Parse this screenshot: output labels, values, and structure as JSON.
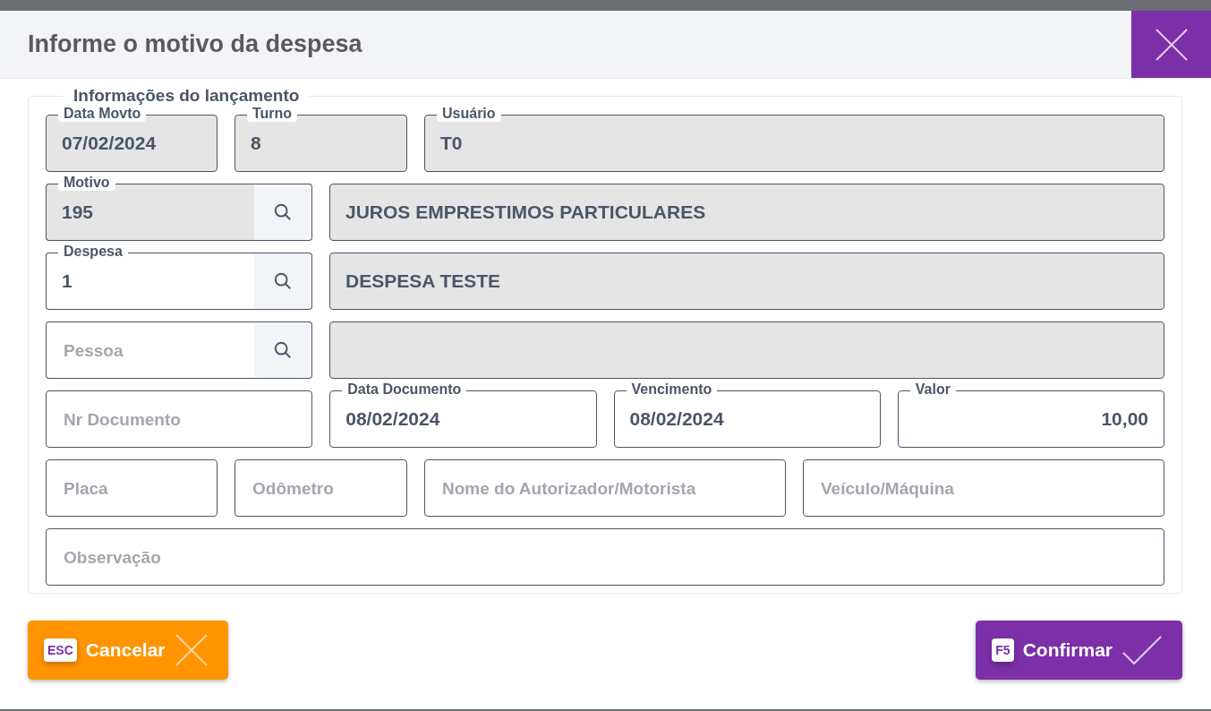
{
  "dialog": {
    "title": "Informe o motivo da despesa"
  },
  "section": {
    "legend": "Informações do lançamento",
    "rows": [
      [
        {
          "kind": "text",
          "label": "Data Movto",
          "value": "07/02/2024",
          "disabled": true
        },
        {
          "kind": "text",
          "label": "Turno",
          "value": "8",
          "disabled": true
        },
        {
          "kind": "text",
          "label": "Usuário",
          "value": "T0",
          "disabled": true
        }
      ],
      [
        {
          "kind": "lookup",
          "label": "Motivo",
          "value": "195",
          "disabled": true
        },
        {
          "kind": "text",
          "value": "JUROS EMPRESTIMOS PARTICULARES",
          "disabled": true
        }
      ],
      [
        {
          "kind": "lookup",
          "label": "Despesa",
          "value": "1",
          "disabled": false
        },
        {
          "kind": "text",
          "value": "DESPESA TESTE",
          "disabled": true
        }
      ],
      [
        {
          "kind": "lookup",
          "placeholder": "Pessoa",
          "disabled": false
        },
        {
          "kind": "text",
          "disabled": true
        }
      ],
      [
        {
          "kind": "text",
          "placeholder": "Nr Documento",
          "disabled": false
        },
        {
          "kind": "text",
          "label": "Data Documento",
          "value": "08/02/2024",
          "disabled": false
        },
        {
          "kind": "text",
          "label": "Vencimento",
          "value": "08/02/2024",
          "disabled": false
        },
        {
          "kind": "number",
          "label": "Valor",
          "value": "10,00",
          "disabled": false
        }
      ],
      [
        {
          "kind": "text",
          "placeholder": "Placa",
          "disabled": false
        },
        {
          "kind": "text",
          "placeholder": "Odômetro",
          "disabled": false
        },
        {
          "kind": "text",
          "placeholder": "Nome do Autorizador/Motorista",
          "disabled": false
        },
        {
          "kind": "text",
          "placeholder": "Veículo/Máquina",
          "disabled": false
        }
      ],
      [
        {
          "kind": "text",
          "placeholder": "Observação",
          "disabled": false
        }
      ]
    ]
  },
  "buttons": [
    {
      "kind": "cancel",
      "key": "ESC",
      "label": "Cancelar"
    },
    {
      "kind": "confirm",
      "key": "F5",
      "label": "Confirmar"
    }
  ]
}
